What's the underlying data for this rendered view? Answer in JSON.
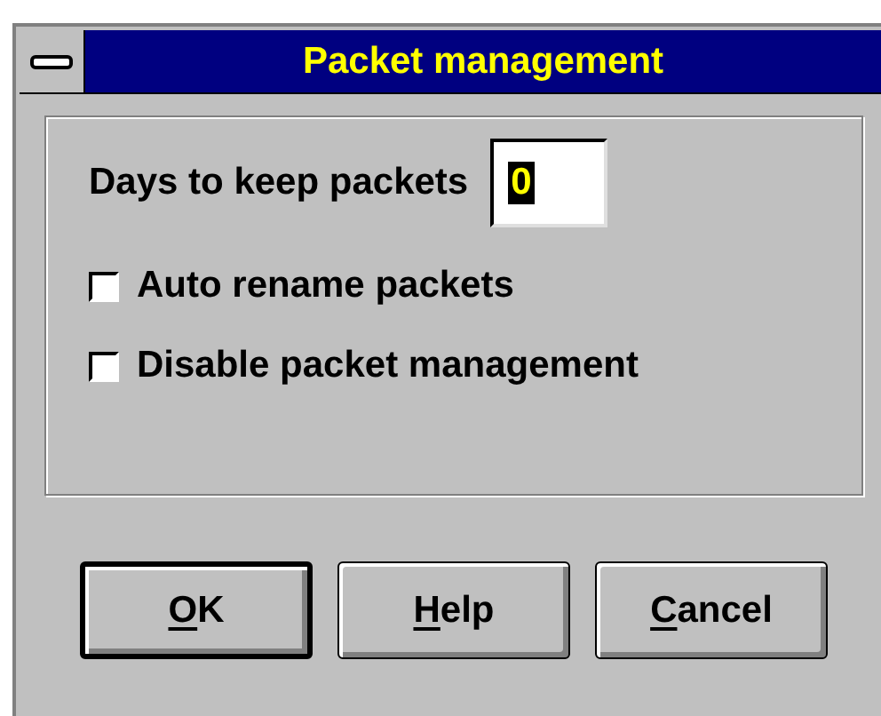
{
  "window": {
    "title": "Packet management"
  },
  "days_field": {
    "label": "Days to keep packets",
    "value": "0",
    "selected": true
  },
  "checkboxes": [
    {
      "label": "Auto rename packets",
      "checked": false
    },
    {
      "label": "Disable packet management",
      "checked": false
    }
  ],
  "buttons": [
    {
      "label": "OK",
      "default": true,
      "underline_first": true
    },
    {
      "label": "Help",
      "default": false,
      "underline_first": true
    },
    {
      "label": "Cancel",
      "default": false,
      "underline_first": true
    }
  ]
}
